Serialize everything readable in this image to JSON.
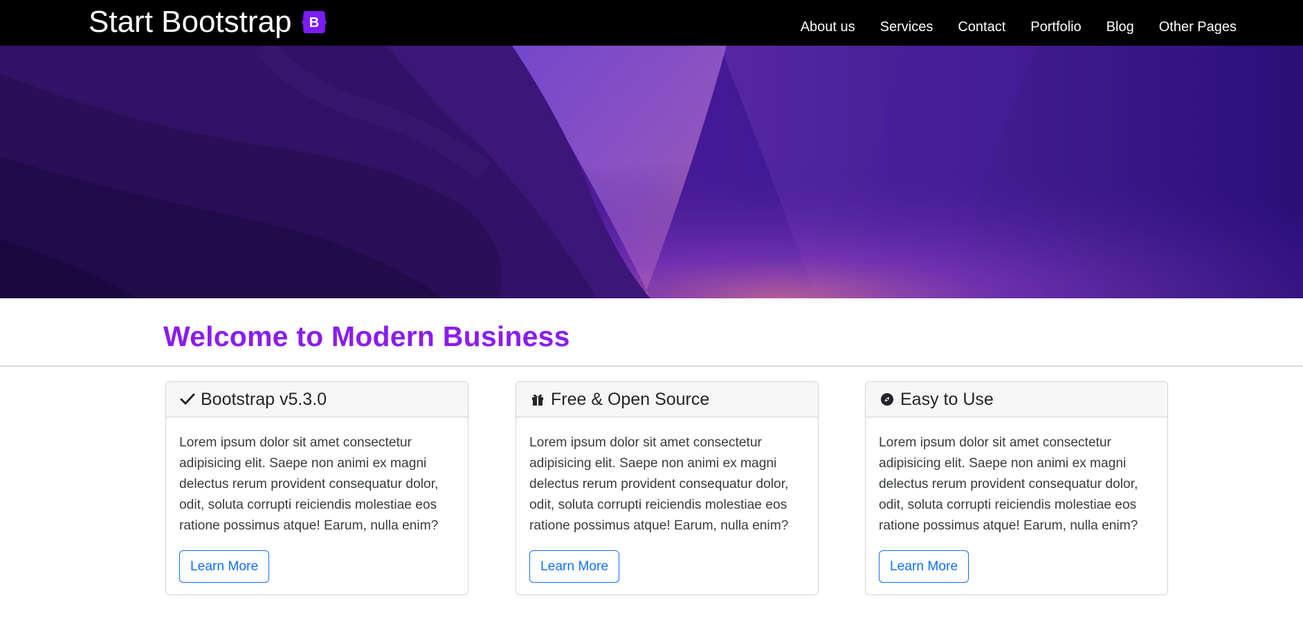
{
  "navbar": {
    "brand": "Start Bootstrap",
    "brand_icon": "bootstrap-logo-icon",
    "brand_icon_color": "#7b1cf4",
    "links": [
      {
        "label": "About us"
      },
      {
        "label": "Services"
      },
      {
        "label": "Contact"
      },
      {
        "label": "Portfolio"
      },
      {
        "label": "Blog"
      },
      {
        "label": "Other Pages"
      }
    ]
  },
  "hero": {
    "image": "purple-abstract-waves-background"
  },
  "main": {
    "heading": "Welcome to Modern Business",
    "heading_color": "#8b1cf0"
  },
  "cards": [
    {
      "icon": "check-icon",
      "title": "Bootstrap v5.3.0",
      "text": "Lorem ipsum dolor sit amet consectetur adipisicing elit. Saepe non animi ex magni delectus rerum provident consequatur dolor, odit, soluta corrupti reiciendis molestiae eos ratione possimus atque! Earum, nulla enim?",
      "button": "Learn More"
    },
    {
      "icon": "gift-icon",
      "title": "Free & Open Source",
      "text": "Lorem ipsum dolor sit amet consectetur adipisicing elit. Saepe non animi ex magni delectus rerum provident consequatur dolor, odit, soluta corrupti reiciendis molestiae eos ratione possimus atque! Earum, nulla enim?",
      "button": "Learn More"
    },
    {
      "icon": "compass-icon",
      "title": "Easy to Use",
      "text": "Lorem ipsum dolor sit amet consectetur adipisicing elit. Saepe non animi ex magni delectus rerum provident consequatur dolor, odit, soluta corrupti reiciendis molestiae eos ratione possimus atque! Earum, nulla enim?",
      "button": "Learn More"
    }
  ],
  "colors": {
    "accent": "#8b1cf0",
    "button": "#0d6efd",
    "navbar": "#000000"
  }
}
